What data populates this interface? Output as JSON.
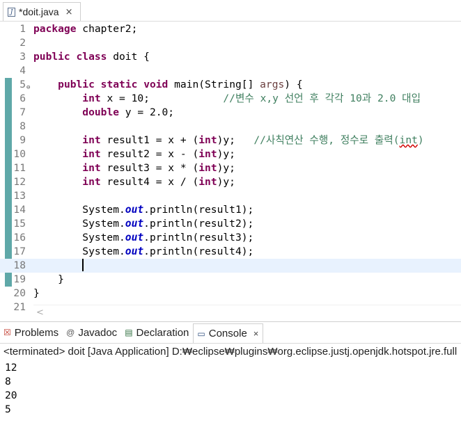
{
  "editor_tab": {
    "label": "*doit.java",
    "close": "×"
  },
  "lines": [
    {
      "n": "1",
      "tokens": [
        {
          "t": "package",
          "c": "kw"
        },
        {
          "t": " chapter2;"
        }
      ]
    },
    {
      "n": "2",
      "tokens": []
    },
    {
      "n": "3",
      "tokens": [
        {
          "t": "public",
          "c": "kw"
        },
        {
          "t": " "
        },
        {
          "t": "class",
          "c": "kw"
        },
        {
          "t": " doit {"
        }
      ]
    },
    {
      "n": "4",
      "tokens": []
    },
    {
      "n": "5",
      "fold": "⊖",
      "tokens": [
        {
          "t": "    "
        },
        {
          "t": "public",
          "c": "kw"
        },
        {
          "t": " "
        },
        {
          "t": "static",
          "c": "kw"
        },
        {
          "t": " "
        },
        {
          "t": "void",
          "c": "kw"
        },
        {
          "t": " main(String[] "
        },
        {
          "t": "args",
          "c": "param"
        },
        {
          "t": ") {"
        }
      ]
    },
    {
      "n": "6",
      "tokens": [
        {
          "t": "        "
        },
        {
          "t": "int",
          "c": "kw"
        },
        {
          "t": " x = 10;            "
        },
        {
          "t": "//변수 x,y 선언 후 각각 10과 2.0 대입",
          "c": "cm"
        }
      ]
    },
    {
      "n": "7",
      "tokens": [
        {
          "t": "        "
        },
        {
          "t": "double",
          "c": "kw"
        },
        {
          "t": " y = 2.0;"
        }
      ]
    },
    {
      "n": "8",
      "tokens": []
    },
    {
      "n": "9",
      "tokens": [
        {
          "t": "        "
        },
        {
          "t": "int",
          "c": "kw"
        },
        {
          "t": " result1 = x + ("
        },
        {
          "t": "int",
          "c": "kw"
        },
        {
          "t": ")y;   "
        },
        {
          "t": "//사칙연산 수행, 정수로 출력(",
          "c": "cm"
        },
        {
          "t": "int",
          "c": "cm squiggle"
        },
        {
          "t": ")",
          "c": "cm"
        }
      ]
    },
    {
      "n": "10",
      "tokens": [
        {
          "t": "        "
        },
        {
          "t": "int",
          "c": "kw"
        },
        {
          "t": " result2 = x - ("
        },
        {
          "t": "int",
          "c": "kw"
        },
        {
          "t": ")y;"
        }
      ]
    },
    {
      "n": "11",
      "tokens": [
        {
          "t": "        "
        },
        {
          "t": "int",
          "c": "kw"
        },
        {
          "t": " result3 = x * ("
        },
        {
          "t": "int",
          "c": "kw"
        },
        {
          "t": ")y;"
        }
      ]
    },
    {
      "n": "12",
      "tokens": [
        {
          "t": "        "
        },
        {
          "t": "int",
          "c": "kw"
        },
        {
          "t": " result4 = x / ("
        },
        {
          "t": "int",
          "c": "kw"
        },
        {
          "t": ")y;"
        }
      ]
    },
    {
      "n": "13",
      "tokens": []
    },
    {
      "n": "14",
      "tokens": [
        {
          "t": "        System."
        },
        {
          "t": "out",
          "c": "fld"
        },
        {
          "t": ".println(result1);"
        }
      ]
    },
    {
      "n": "15",
      "tokens": [
        {
          "t": "        System."
        },
        {
          "t": "out",
          "c": "fld"
        },
        {
          "t": ".println(result2);"
        }
      ]
    },
    {
      "n": "16",
      "tokens": [
        {
          "t": "        System."
        },
        {
          "t": "out",
          "c": "fld"
        },
        {
          "t": ".println(result3);"
        }
      ]
    },
    {
      "n": "17",
      "tokens": [
        {
          "t": "        System."
        },
        {
          "t": "out",
          "c": "fld"
        },
        {
          "t": ".println(result4);"
        }
      ]
    },
    {
      "n": "18",
      "current": true,
      "tokens": [
        {
          "t": "        "
        }
      ]
    },
    {
      "n": "19",
      "tokens": [
        {
          "t": "    }"
        }
      ]
    },
    {
      "n": "20",
      "tokens": [
        {
          "t": "}"
        }
      ]
    },
    {
      "n": "21",
      "tokens": []
    }
  ],
  "hscroll_left": "<",
  "panel": {
    "tabs": [
      {
        "name": "problems",
        "icon": "☒",
        "icon_color": "#c0392b",
        "label": "Problems"
      },
      {
        "name": "javadoc",
        "icon": "@",
        "icon_color": "#555555",
        "label": "Javadoc"
      },
      {
        "name": "declaration",
        "icon": "▤",
        "icon_color": "#2f6f3f",
        "label": "Declaration"
      },
      {
        "name": "console",
        "icon": "▭",
        "icon_color": "#2f4f7f",
        "label": "Console",
        "active": true,
        "close": "×"
      }
    ],
    "status": "<terminated> doit [Java Application] D:₩eclipse₩plugins₩org.eclipse.justj.openjdk.hotspot.jre.full",
    "output": [
      "12",
      "8",
      "20",
      "5"
    ]
  }
}
